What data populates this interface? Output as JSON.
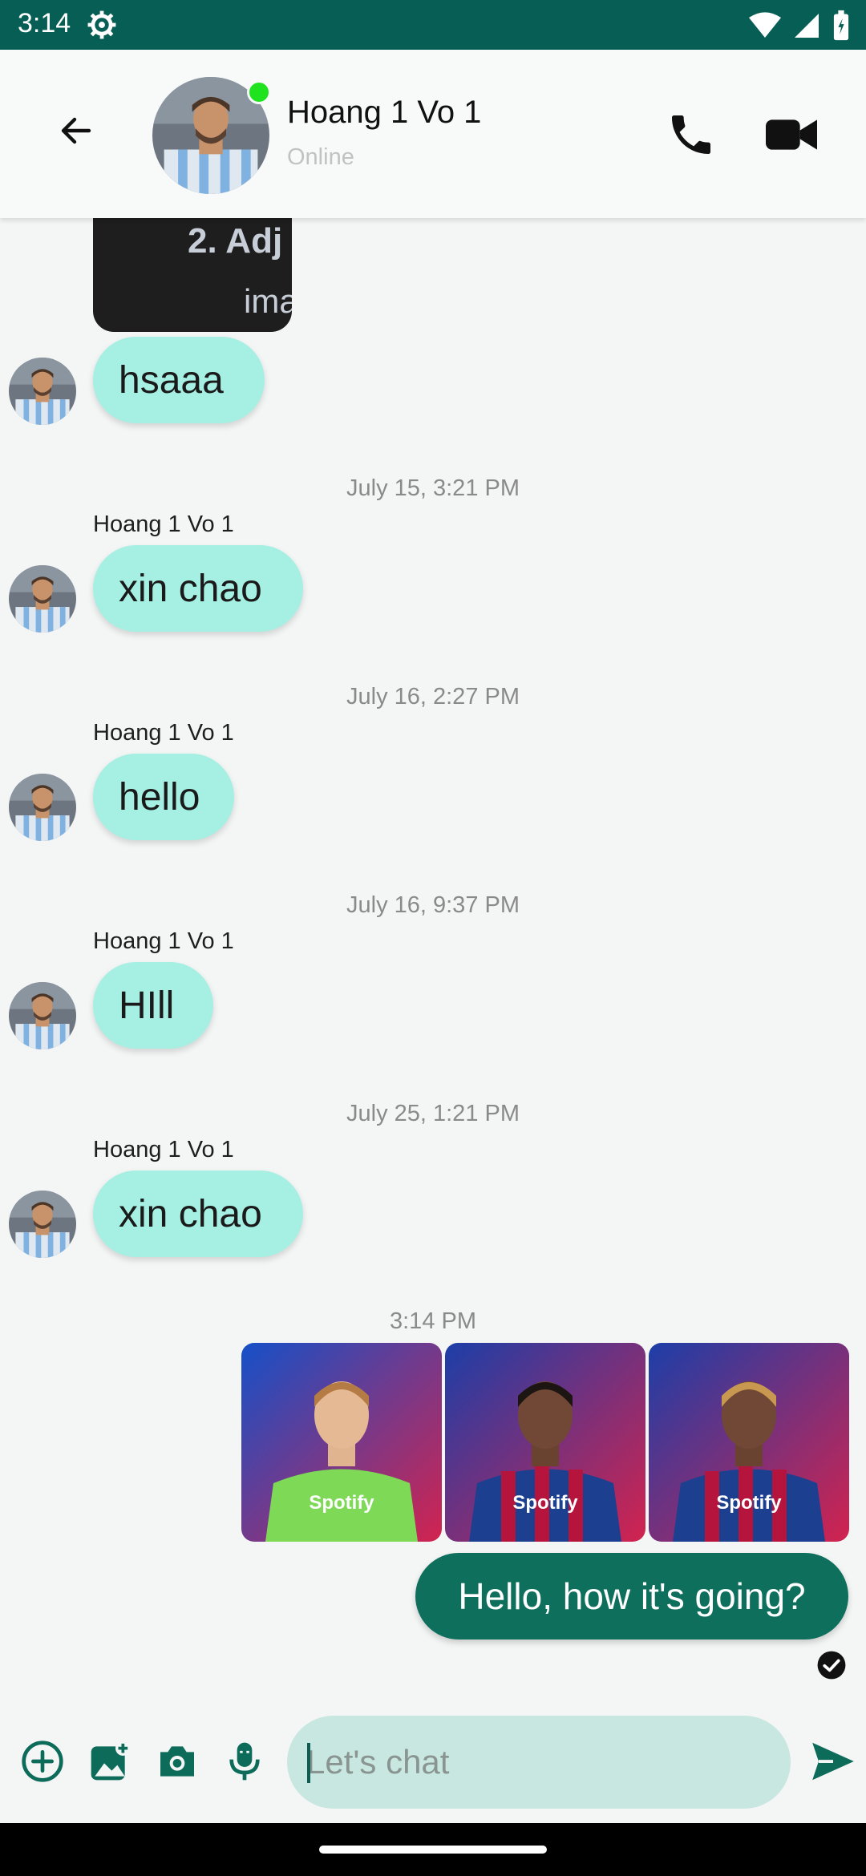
{
  "status_bar": {
    "time": "3:14"
  },
  "header": {
    "contact_name": "Hoang 1 Vo 1",
    "contact_status": "Online"
  },
  "cut_image": {
    "line1": "2.  Adj",
    "line2": "ima"
  },
  "messages": [
    {
      "type": "incoming",
      "text": "hsaaa"
    },
    {
      "type": "timestamp",
      "text": "July 15, 3:21 PM"
    },
    {
      "type": "incoming",
      "sender": "Hoang 1 Vo 1",
      "text": "xin chao"
    },
    {
      "type": "timestamp",
      "text": "July 16, 2:27 PM"
    },
    {
      "type": "incoming",
      "sender": "Hoang 1 Vo 1",
      "text": "hello"
    },
    {
      "type": "timestamp",
      "text": "July 16, 9:37 PM"
    },
    {
      "type": "incoming",
      "sender": "Hoang 1 Vo 1",
      "text": "HIll"
    },
    {
      "type": "timestamp",
      "text": "July 25, 1:21 PM"
    },
    {
      "type": "incoming",
      "sender": "Hoang 1 Vo 1",
      "text": "xin chao"
    },
    {
      "type": "timestamp",
      "text": "3:14 PM"
    },
    {
      "type": "outgoing",
      "text": "Hello, how it's going?"
    }
  ],
  "photos": [
    {
      "shirt": "Spotify",
      "kit_color": "#7ed957"
    },
    {
      "shirt": "Spotify",
      "kit_color": "#1d3f8f"
    },
    {
      "shirt": "Spotify",
      "kit_color": "#1d3f8f"
    }
  ],
  "composer": {
    "placeholder": "Let's chat"
  },
  "colors": {
    "status_bar": "#075e54",
    "incoming_bubble": "#a5f0e3",
    "outgoing_bubble": "#0f6f5d",
    "input_bg": "#c8e7e0",
    "accent": "#0d6b5a",
    "online_dot": "#1ee31e"
  },
  "icons": [
    "back-arrow-icon",
    "phone-icon",
    "video-camera-icon",
    "add-circle-icon",
    "gallery-add-icon",
    "camera-icon",
    "microphone-icon",
    "send-icon",
    "read-check-icon",
    "settings-gear-icon",
    "wifi-icon",
    "signal-icon",
    "battery-icon"
  ]
}
